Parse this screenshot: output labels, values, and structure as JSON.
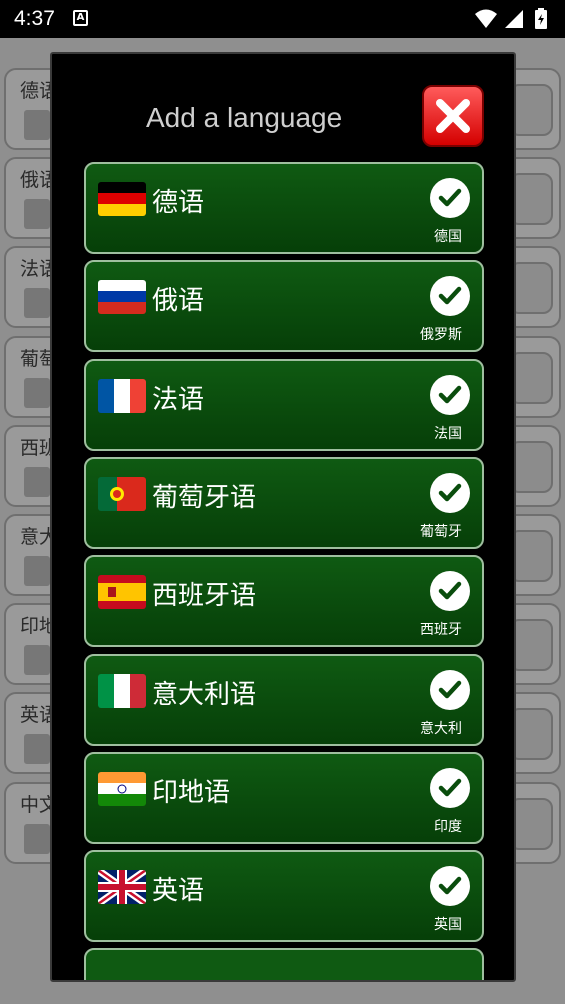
{
  "status_bar": {
    "time": "4:37",
    "notification_icon": "A"
  },
  "background_rows": [
    {
      "label": "德语"
    },
    {
      "label": "俄语"
    },
    {
      "label": "法语"
    },
    {
      "label": "葡萄"
    },
    {
      "label": "西班"
    },
    {
      "label": "意大"
    },
    {
      "label": "印地"
    },
    {
      "label": "英语"
    },
    {
      "label": "中文"
    }
  ],
  "dialog": {
    "title": "Add a language",
    "close_icon": "close-x-icon",
    "items": [
      {
        "name": "德语",
        "country": "德国",
        "flag": "de",
        "checked": true
      },
      {
        "name": "俄语",
        "country": "俄罗斯",
        "flag": "ru",
        "checked": true
      },
      {
        "name": "法语",
        "country": "法国",
        "flag": "fr",
        "checked": true
      },
      {
        "name": "葡萄牙语",
        "country": "葡萄牙",
        "flag": "pt",
        "checked": true
      },
      {
        "name": "西班牙语",
        "country": "西班牙",
        "flag": "es",
        "checked": true
      },
      {
        "name": "意大利语",
        "country": "意大利",
        "flag": "it",
        "checked": true
      },
      {
        "name": "印地语",
        "country": "印度",
        "flag": "in",
        "checked": true
      },
      {
        "name": "英语",
        "country": "英国",
        "flag": "gb",
        "checked": true
      }
    ]
  },
  "colors": {
    "item_green": "#0a4d0d",
    "close_red": "#e00000",
    "dialog_bg": "#000000"
  }
}
